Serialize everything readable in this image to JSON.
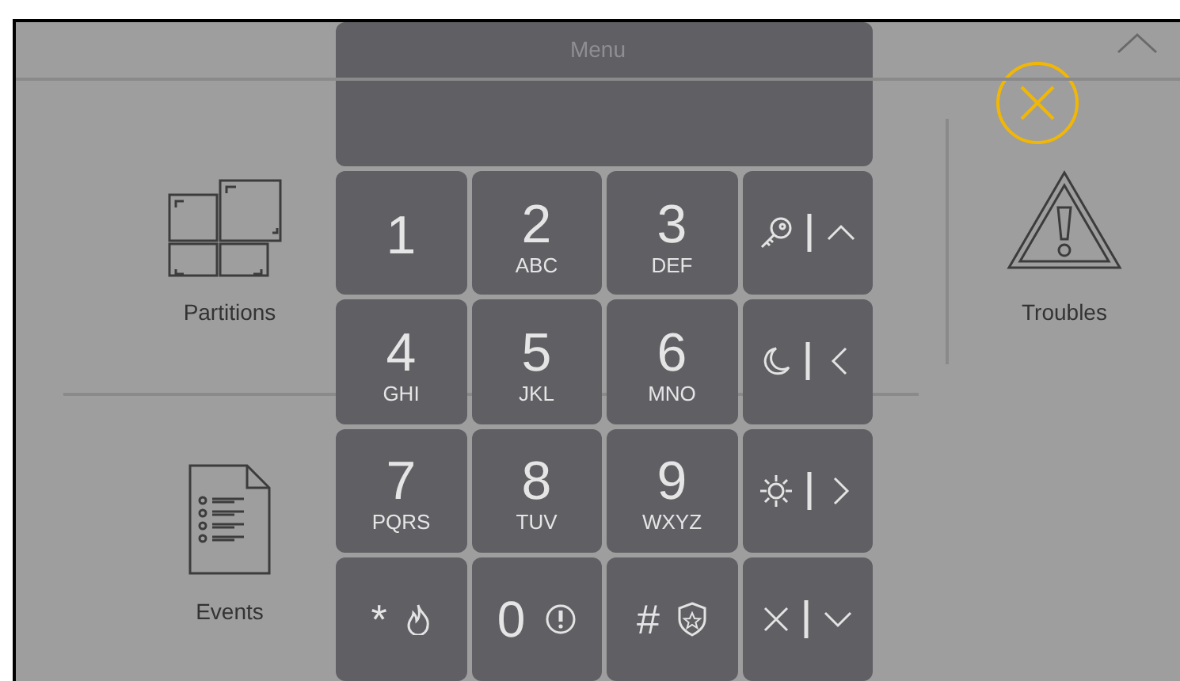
{
  "header": {
    "title": "Menu"
  },
  "tiles": [
    {
      "label": "Partitions",
      "kind": "partitions"
    },
    {
      "label": "Troubles",
      "kind": "troubles"
    },
    {
      "label": "Events",
      "kind": "events"
    }
  ],
  "keypad": {
    "keys": [
      {
        "kind": "digit",
        "label": "1"
      },
      {
        "kind": "digit",
        "label": "2",
        "letters": "ABC"
      },
      {
        "kind": "digit",
        "label": "3",
        "letters": "DEF"
      },
      {
        "kind": "key"
      },
      {
        "kind": "digit",
        "label": "4",
        "letters": "GHI"
      },
      {
        "kind": "digit",
        "label": "5",
        "letters": "JKL"
      },
      {
        "kind": "digit",
        "label": "6",
        "letters": "MNO"
      },
      {
        "kind": "moon"
      },
      {
        "kind": "digit",
        "label": "7",
        "letters": "PQRS"
      },
      {
        "kind": "digit",
        "label": "8",
        "letters": "TUV"
      },
      {
        "kind": "digit",
        "label": "9",
        "letters": "WXYZ"
      },
      {
        "kind": "sun"
      },
      {
        "kind": "fire",
        "label": "*"
      },
      {
        "kind": "panic",
        "label": "0"
      },
      {
        "kind": "police",
        "label": "#"
      },
      {
        "kind": "clear"
      }
    ]
  }
}
